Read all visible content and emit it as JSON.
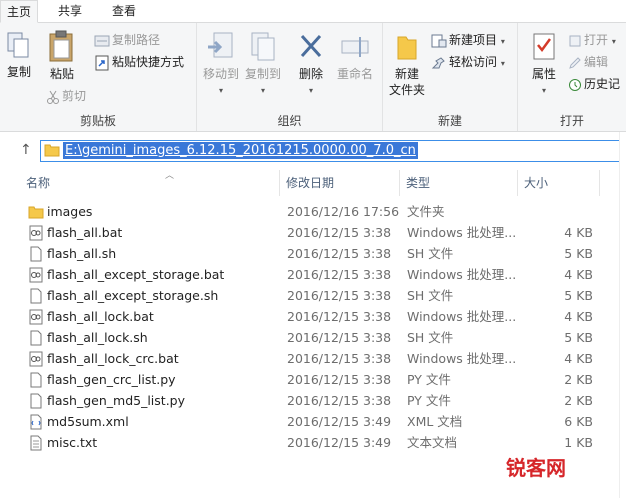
{
  "tabs": [
    {
      "label": "主页"
    },
    {
      "label": "共享"
    },
    {
      "label": "查看"
    }
  ],
  "ribbon": {
    "clipboard": {
      "group_label": "剪贴板",
      "copy": "复制",
      "paste": "粘贴",
      "copy_path": "复制路径",
      "paste_shortcut": "粘贴快捷方式",
      "cut": "剪切"
    },
    "organize": {
      "group_label": "组织",
      "move_to": "移动到",
      "copy_to": "复制到",
      "delete": "删除",
      "rename": "重命名"
    },
    "new": {
      "group_label": "新建",
      "new_folder": "新建\n文件夹",
      "new_folder_line1": "新建",
      "new_folder_line2": "文件夹",
      "new_item": "新建项目",
      "easy_access": "轻松访问"
    },
    "open": {
      "group_label": "打开",
      "properties": "属性",
      "open": "打开",
      "edit": "编辑",
      "history": "历史记"
    }
  },
  "address": {
    "path": "E:\\gemini_images_6.12.15_20161215.0000.00_7.0_cn"
  },
  "columns": {
    "name": "名称",
    "date": "修改日期",
    "type": "类型",
    "size": "大小"
  },
  "files": [
    {
      "name": "images",
      "date": "2016/12/16 17:56",
      "type": "文件夹",
      "size": "",
      "icon": "folder-icon"
    },
    {
      "name": "flash_all.bat",
      "date": "2016/12/15 3:38",
      "type": "Windows 批处理...",
      "size": "4 KB",
      "icon": "batch-file-icon"
    },
    {
      "name": "flash_all.sh",
      "date": "2016/12/15 3:38",
      "type": "SH 文件",
      "size": "5 KB",
      "icon": "file-icon"
    },
    {
      "name": "flash_all_except_storage.bat",
      "date": "2016/12/15 3:38",
      "type": "Windows 批处理...",
      "size": "4 KB",
      "icon": "batch-file-icon"
    },
    {
      "name": "flash_all_except_storage.sh",
      "date": "2016/12/15 3:38",
      "type": "SH 文件",
      "size": "5 KB",
      "icon": "file-icon"
    },
    {
      "name": "flash_all_lock.bat",
      "date": "2016/12/15 3:38",
      "type": "Windows 批处理...",
      "size": "4 KB",
      "icon": "batch-file-icon"
    },
    {
      "name": "flash_all_lock.sh",
      "date": "2016/12/15 3:38",
      "type": "SH 文件",
      "size": "5 KB",
      "icon": "file-icon"
    },
    {
      "name": "flash_all_lock_crc.bat",
      "date": "2016/12/15 3:38",
      "type": "Windows 批处理...",
      "size": "4 KB",
      "icon": "batch-file-icon"
    },
    {
      "name": "flash_gen_crc_list.py",
      "date": "2016/12/15 3:38",
      "type": "PY 文件",
      "size": "2 KB",
      "icon": "file-icon"
    },
    {
      "name": "flash_gen_md5_list.py",
      "date": "2016/12/15 3:38",
      "type": "PY 文件",
      "size": "2 KB",
      "icon": "file-icon"
    },
    {
      "name": "md5sum.xml",
      "date": "2016/12/15 3:49",
      "type": "XML 文档",
      "size": "6 KB",
      "icon": "xml-file-icon"
    },
    {
      "name": "misc.txt",
      "date": "2016/12/15 3:49",
      "type": "文本文档",
      "size": "1 KB",
      "icon": "text-file-icon"
    }
  ],
  "watermark": {
    "logo": "锐客网"
  },
  "colors": {
    "accent": "#3a78d8",
    "ribbon_bg": "#f5f6f7",
    "folder": "#f5c84a"
  }
}
